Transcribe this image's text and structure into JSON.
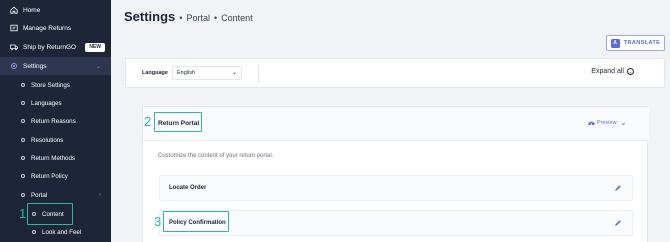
{
  "sidebar": {
    "items": [
      {
        "label": "Home",
        "icon": "home-icon"
      },
      {
        "label": "Manage Returns",
        "icon": "returns-icon"
      },
      {
        "label": "Ship by ReturnGO",
        "icon": "truck-icon",
        "badge": "NEW"
      },
      {
        "label": "Settings",
        "icon": "gear-icon"
      }
    ],
    "settings_children": [
      {
        "label": "Store Settings"
      },
      {
        "label": "Languages"
      },
      {
        "label": "Return Reasons"
      },
      {
        "label": "Resolutions"
      },
      {
        "label": "Return Methods"
      },
      {
        "label": "Return Policy"
      },
      {
        "label": "Portal"
      }
    ],
    "portal_children": [
      {
        "label": "Content"
      },
      {
        "label": "Look and Feel"
      }
    ]
  },
  "annotations": {
    "step1": "1",
    "step2": "2",
    "step3": "3"
  },
  "header": {
    "title": "Settings",
    "crumb1": "Portal",
    "crumb2": "Content",
    "separator": "•"
  },
  "toolbar": {
    "translate_label": "TRANSLATE"
  },
  "language": {
    "label": "Language",
    "selected": "English"
  },
  "expand_all_label": "Expand all",
  "panel": {
    "title": "Return Portal",
    "preview_label": "Preview",
    "description": "Customize the content of your return portal.",
    "rows": [
      {
        "label": "Locate Order"
      },
      {
        "label": "Policy Confirmation"
      }
    ]
  },
  "colors": {
    "sidebar": "#1e2538",
    "accent": "#5a69e6",
    "annotation": "#27b8a8"
  }
}
